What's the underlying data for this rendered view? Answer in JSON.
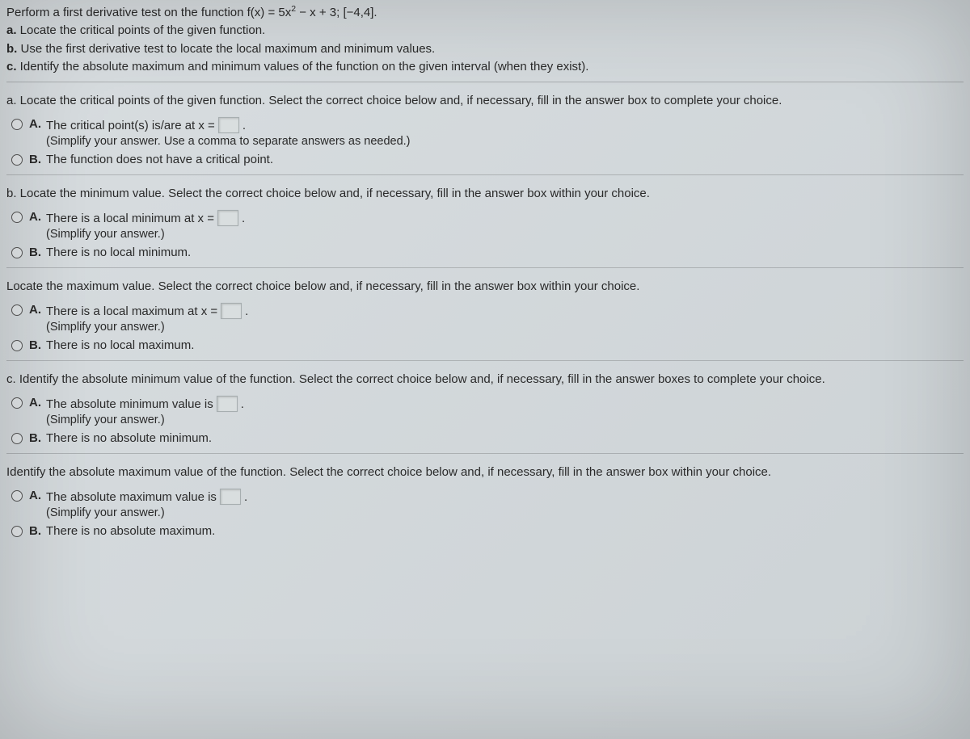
{
  "intro": {
    "line1_pre": "Perform a first derivative test on the function f(x) = 5x",
    "line1_exp": "2",
    "line1_post": " − x + 3; [−4,4].",
    "bullet_a": "a.",
    "text_a": " Locate the critical points of the given function.",
    "bullet_b": "b.",
    "text_b": " Use the first derivative test to locate the local maximum and minimum values.",
    "bullet_c": "c.",
    "text_c": " Identify the absolute maximum and minimum values of the function on the given interval (when they exist)."
  },
  "qa": {
    "prompt": "a. Locate the critical points of the given function. Select the correct choice below and, if necessary, fill in the answer box to complete your choice.",
    "opt_a_label": "A.",
    "opt_a_text": "The critical point(s) is/are at x =",
    "opt_a_post": ".",
    "opt_a_hint": "(Simplify your answer. Use a comma to separate answers as needed.)",
    "opt_b_label": "B.",
    "opt_b_text": "The function does not have a critical point."
  },
  "qb_min": {
    "prompt": "b. Locate the minimum value. Select the correct choice below and, if necessary, fill in the answer box within your choice.",
    "opt_a_label": "A.",
    "opt_a_text": "There is a local minimum at x =",
    "opt_a_post": ".",
    "opt_a_hint": "(Simplify your answer.)",
    "opt_b_label": "B.",
    "opt_b_text": "There is no local minimum."
  },
  "qb_max": {
    "prompt": "Locate the maximum value. Select the correct choice below and, if necessary, fill in the answer box within your choice.",
    "opt_a_label": "A.",
    "opt_a_text": "There is a local maximum at x =",
    "opt_a_post": ".",
    "opt_a_hint": "(Simplify your answer.)",
    "opt_b_label": "B.",
    "opt_b_text": "There is no local maximum."
  },
  "qc_min": {
    "prompt": "c. Identify the absolute minimum value of the function. Select the correct choice below and, if necessary, fill in the answer boxes to complete your choice.",
    "opt_a_label": "A.",
    "opt_a_text": "The absolute minimum value is",
    "opt_a_post": ".",
    "opt_a_hint": "(Simplify your answer.)",
    "opt_b_label": "B.",
    "opt_b_text": "There is no absolute minimum."
  },
  "qc_max": {
    "prompt": "Identify the absolute maximum value of the function. Select the correct choice below and, if necessary, fill in the answer box within your choice.",
    "opt_a_label": "A.",
    "opt_a_text": "The absolute maximum value is",
    "opt_a_post": ".",
    "opt_a_hint": "(Simplify your answer.)",
    "opt_b_label": "B.",
    "opt_b_text": "There is no absolute maximum."
  }
}
